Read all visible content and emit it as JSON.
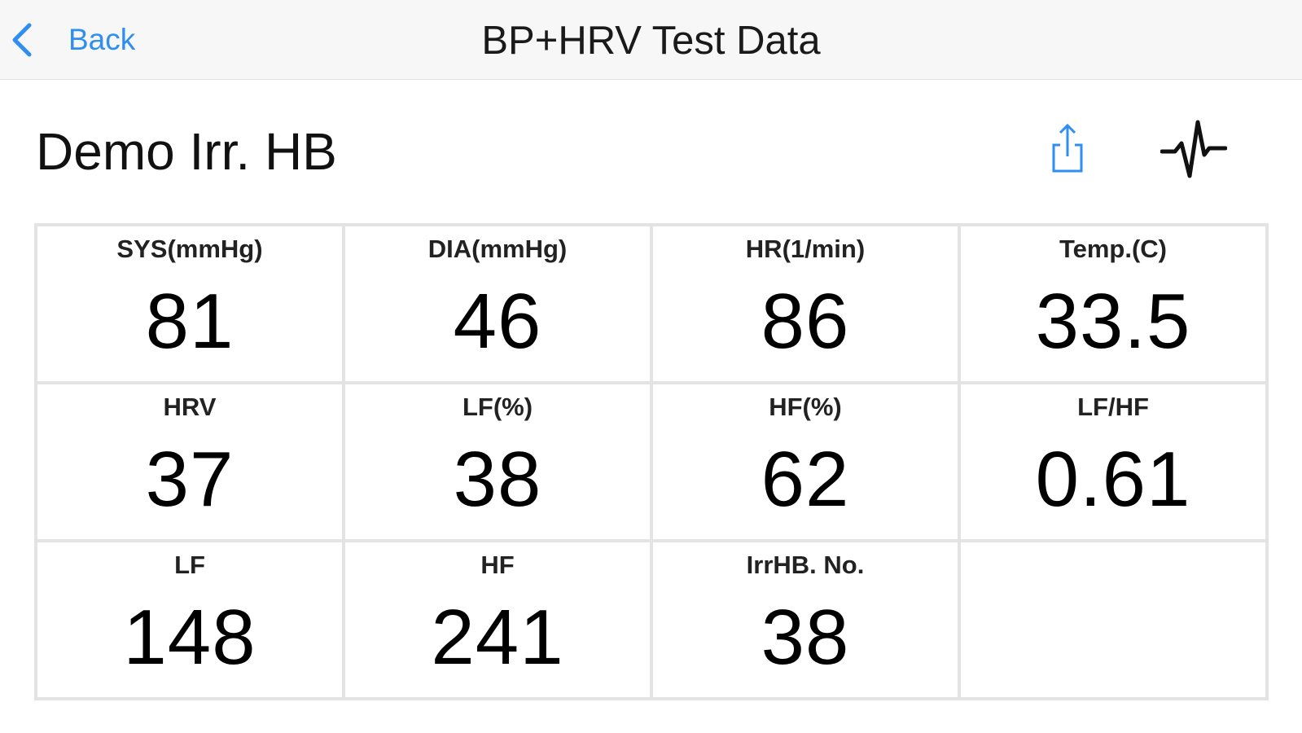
{
  "nav": {
    "back_label": "Back",
    "title": "BP+HRV Test Data",
    "accent_color": "#2f8ef0"
  },
  "record": {
    "name": "Demo Irr. HB",
    "share_icon": "share-icon",
    "pulse_icon": "pulse-waveform-icon"
  },
  "metrics": [
    {
      "label": "SYS(mmHg)",
      "value": "81"
    },
    {
      "label": "DIA(mmHg)",
      "value": "46"
    },
    {
      "label": "HR(1/min)",
      "value": "86"
    },
    {
      "label": "Temp.(C)",
      "value": "33.5"
    },
    {
      "label": "HRV",
      "value": "37"
    },
    {
      "label": "LF(%)",
      "value": "38"
    },
    {
      "label": "HF(%)",
      "value": "62"
    },
    {
      "label": "LF/HF",
      "value": "0.61"
    },
    {
      "label": "LF",
      "value": "148"
    },
    {
      "label": "HF",
      "value": "241"
    },
    {
      "label": "IrrHB. No.",
      "value": "38"
    },
    {
      "label": "",
      "value": ""
    }
  ]
}
